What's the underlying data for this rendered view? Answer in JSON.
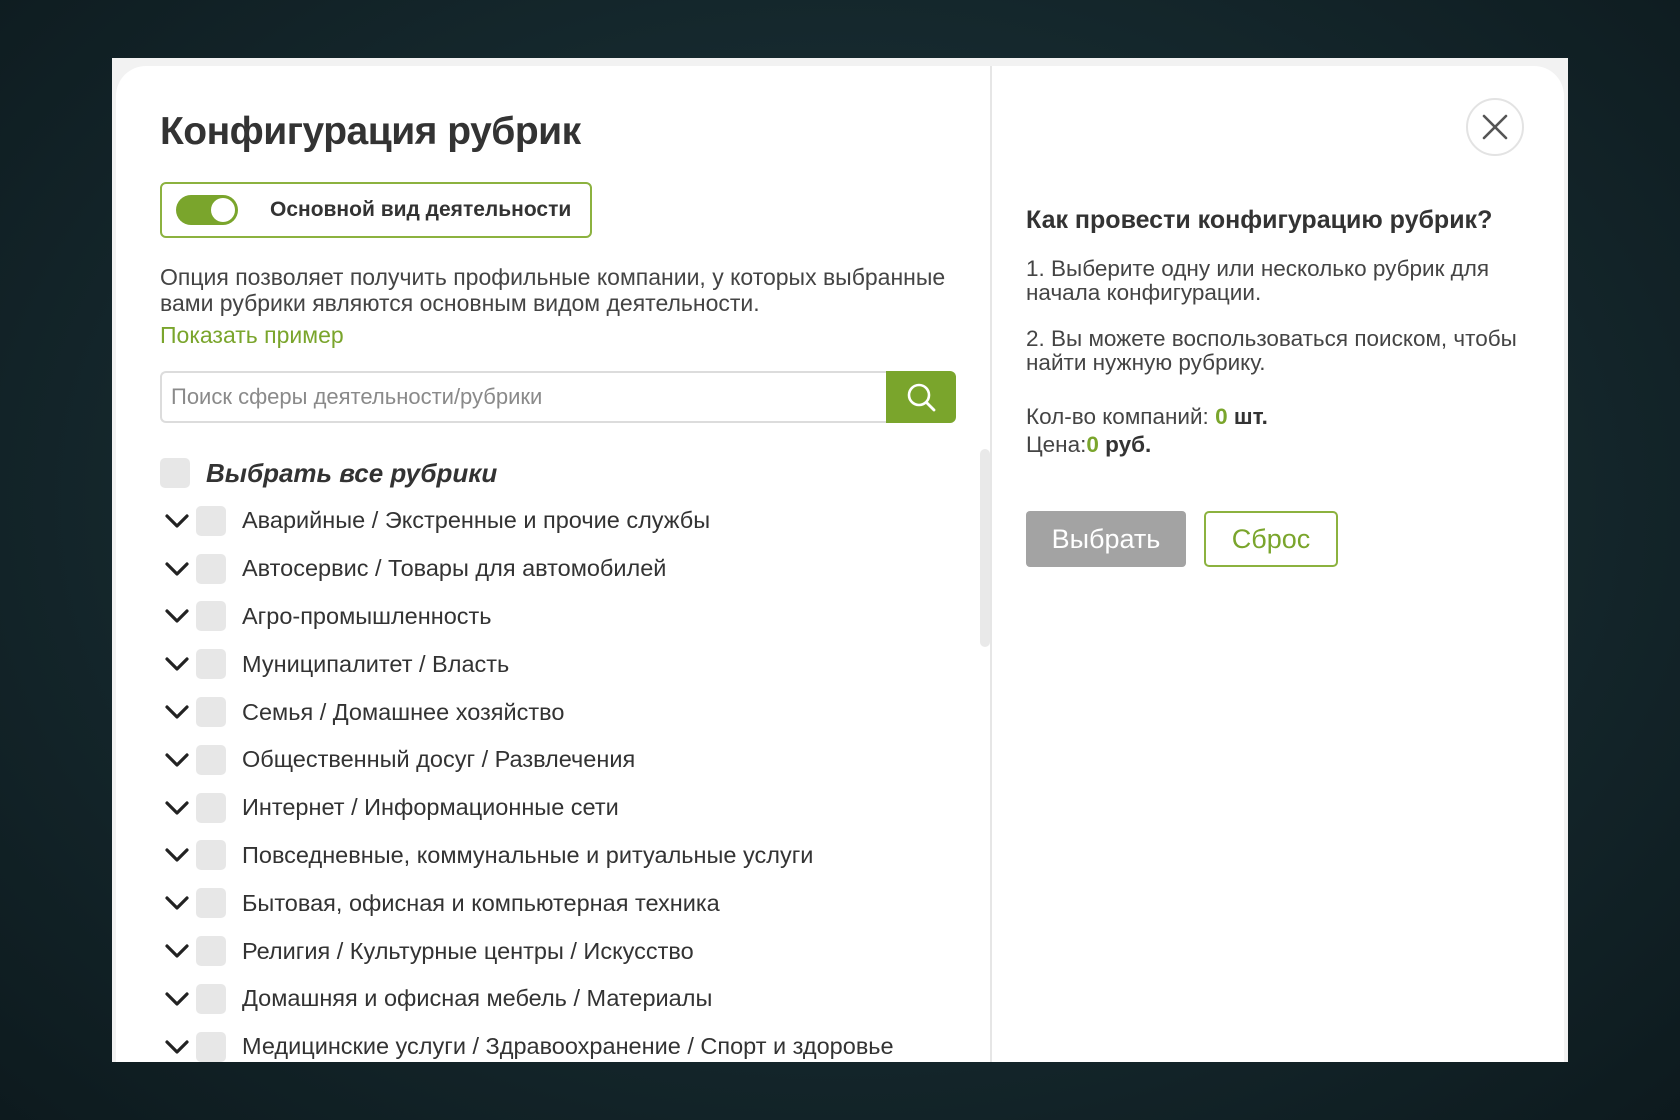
{
  "modal": {
    "title": "Конфигурация рубрик",
    "toggle": {
      "label": "Основной вид деятельности",
      "on": true
    },
    "description": "Опция позволяет получить профильные компании, у которых выбранные вами рубрики являются основным видом деятельности.",
    "example_link": "Показать пример",
    "search": {
      "placeholder": "Поиск сферы деятельности/рубрики",
      "value": ""
    },
    "select_all_label": "Выбрать все рубрики",
    "categories": [
      "Аварийные / Экстренные и прочие службы",
      "Автосервис / Товары для автомобилей",
      "Агро-промышленность",
      "Муниципалитет / Власть",
      "Семья / Домашнее хозяйство",
      "Общественный досуг / Развлечения",
      "Интернет / Информационные сети",
      "Повседневные, коммунальные и ритуальные услуги",
      "Бытовая, офисная и компьютерная техника",
      "Религия / Культурные центры / Искусство",
      "Домашняя и офисная мебель / Материалы",
      "Медицинские услуги / Здравоохранение / Спорт и здоровье"
    ]
  },
  "help": {
    "title": "Как провести конфигурацию рубрик?",
    "step1": "1. Выберите одну или несколько рубрик для начала конфигурации.",
    "step2": "2. Вы можете воспользоваться поиском, чтобы найти нужную рубрику.",
    "count_label": "Кол-во компаний:",
    "count_value": "0",
    "count_unit": "шт.",
    "price_label": "Цена:",
    "price_value": "0",
    "price_unit": "руб.",
    "select_button": "Выбрать",
    "reset_button": "Сброс"
  },
  "colors": {
    "accent": "#7aa52c",
    "button_disabled": "#a3a3a3"
  },
  "icons": {
    "search": "search-icon",
    "close": "close-icon",
    "expand": "chevron-down-icon"
  }
}
